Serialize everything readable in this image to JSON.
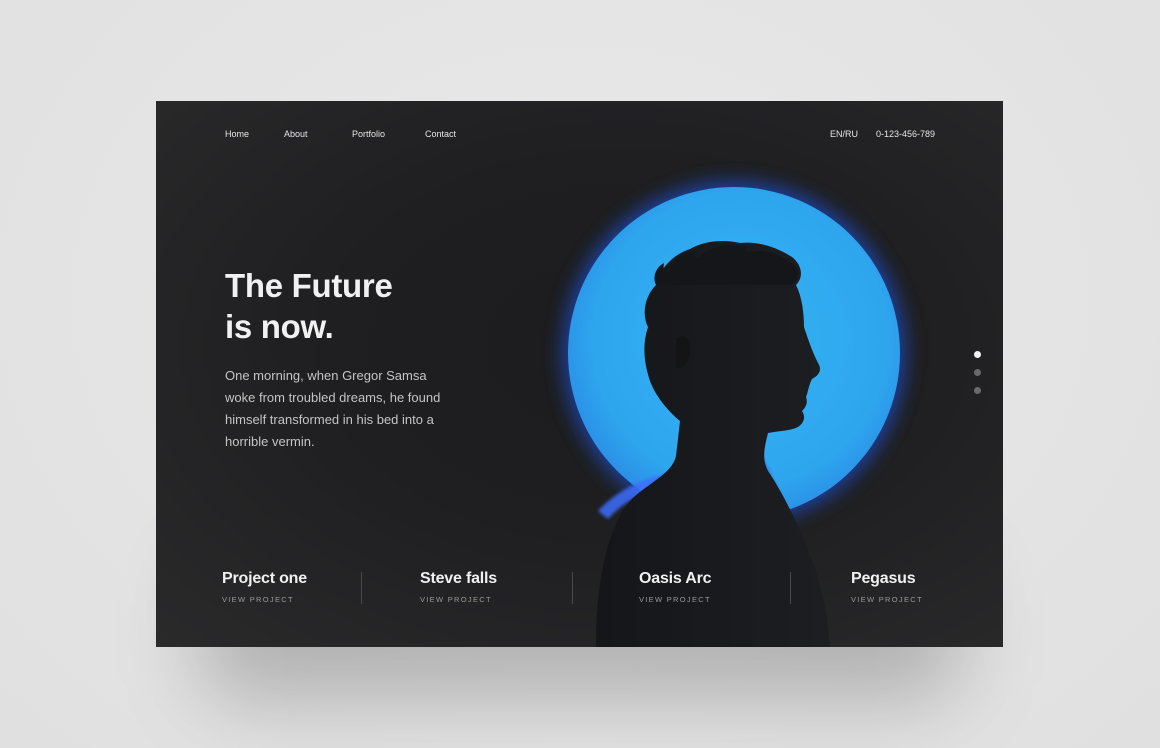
{
  "nav": {
    "links": [
      "Home",
      "About",
      "Portfolio",
      "Contact"
    ],
    "language": "EN/RU",
    "phone": "0-123-456-789"
  },
  "hero": {
    "title_line1": "The Future",
    "title_line2": "is now.",
    "body": "One morning, when Gregor Samsa woke from troubled dreams, he found himself transformed in his bed into a horrible vermin."
  },
  "slider": {
    "count": 3,
    "active_index": 0
  },
  "projects": [
    {
      "name": "Project one",
      "link": "VIEW PROJECT"
    },
    {
      "name": "Steve falls",
      "link": "VIEW PROJECT"
    },
    {
      "name": "Oasis Arc",
      "link": "VIEW PROJECT"
    },
    {
      "name": "Pegasus",
      "link": "VIEW PROJECT"
    }
  ],
  "colors": {
    "background": "#e4e4e4",
    "card": "#1f1f21",
    "accent_blue": "#2ea6ee",
    "text_primary": "#f1f1f1",
    "text_secondary": "#c4c4c4"
  },
  "icons": {
    "portrait": "silhouette-portrait-icon"
  }
}
